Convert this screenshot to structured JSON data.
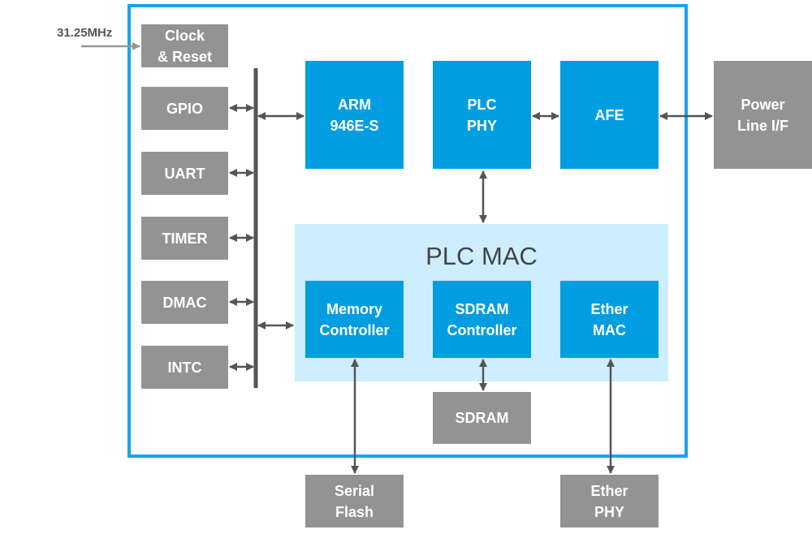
{
  "clock_input": "31.25MHz",
  "colors": {
    "frame": "#1aa3e8",
    "core_block": "#009ee0",
    "peripheral_block": "#939393",
    "mac_region": "#cdeefe",
    "arrow": "#555555"
  },
  "peripherals": [
    "Clock\n& Reset",
    "GPIO",
    "UART",
    "TIMER",
    "DMAC",
    "INTC"
  ],
  "core": {
    "arm": "ARM\n946E-S",
    "plc_phy": "PLC\nPHY",
    "afe": "AFE"
  },
  "external": {
    "power_line": "Power\nLine I/F",
    "sdram": "SDRAM",
    "serial_flash": "Serial\nFlash",
    "ether_phy": "Ether\nPHY"
  },
  "plc_mac": {
    "title": "PLC MAC",
    "memory_controller": "Memory\nController",
    "sdram_controller": "SDRAM\nController",
    "ether_mac": "Ether\nMAC"
  }
}
